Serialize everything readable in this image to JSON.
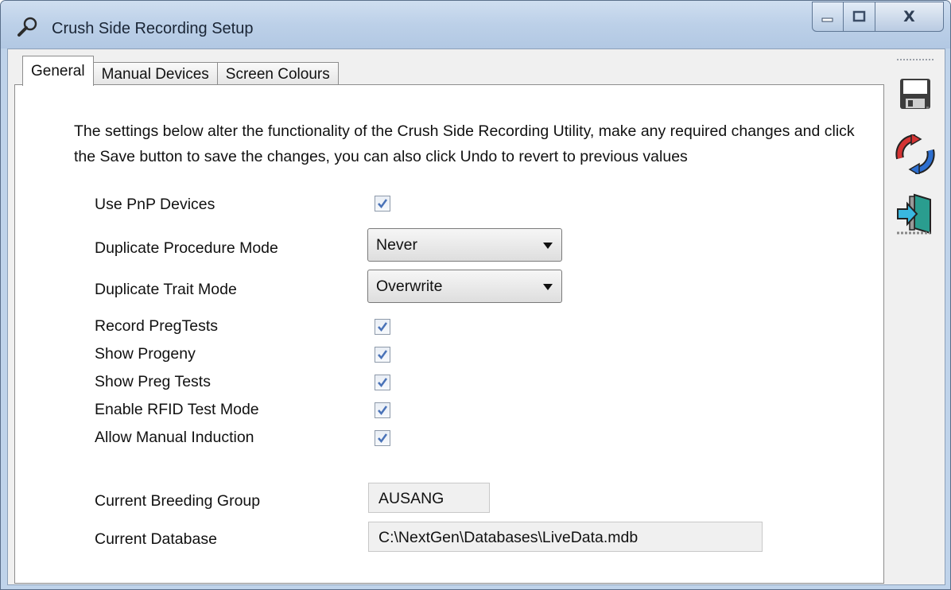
{
  "window": {
    "title": "Crush Side Recording Setup",
    "icon": "wrench-icon",
    "close_glyph": "X"
  },
  "tabs": [
    {
      "label": "General",
      "active": true
    },
    {
      "label": "Manual Devices",
      "active": false
    },
    {
      "label": "Screen Colours",
      "active": false
    }
  ],
  "general": {
    "description": "The settings below alter the functionality of the Crush Side Recording Utility, make any required changes and click the Save button to save the changes, you can also click Undo to revert to previous values",
    "use_pnp": {
      "label": "Use PnP Devices",
      "checked": true
    },
    "dup_procedure": {
      "label": "Duplicate Procedure Mode",
      "value": "Never"
    },
    "dup_trait": {
      "label": "Duplicate Trait Mode",
      "value": "Overwrite"
    },
    "record_pregtests": {
      "label": "Record PregTests",
      "checked": true
    },
    "show_progeny": {
      "label": "Show Progeny",
      "checked": true
    },
    "show_preg_tests": {
      "label": "Show Preg Tests",
      "checked": true
    },
    "rfid_test_mode": {
      "label": "Enable RFID Test Mode",
      "checked": true
    },
    "manual_induction": {
      "label": "Allow Manual Induction",
      "checked": true
    },
    "breeding_group": {
      "label": "Current Breeding Group",
      "value": "AUSANG"
    },
    "database": {
      "label": "Current Database",
      "value": "C:\\NextGen\\Databases\\LiveData.mdb"
    }
  },
  "toolbar": {
    "items": [
      "save-floppy-icon",
      "undo-refresh-icon",
      "exit-door-icon"
    ]
  },
  "colors": {
    "titlebar": "#bcd0e8",
    "panel": "#ffffff",
    "client": "#f0f0f0",
    "check": "#4a73b8"
  }
}
